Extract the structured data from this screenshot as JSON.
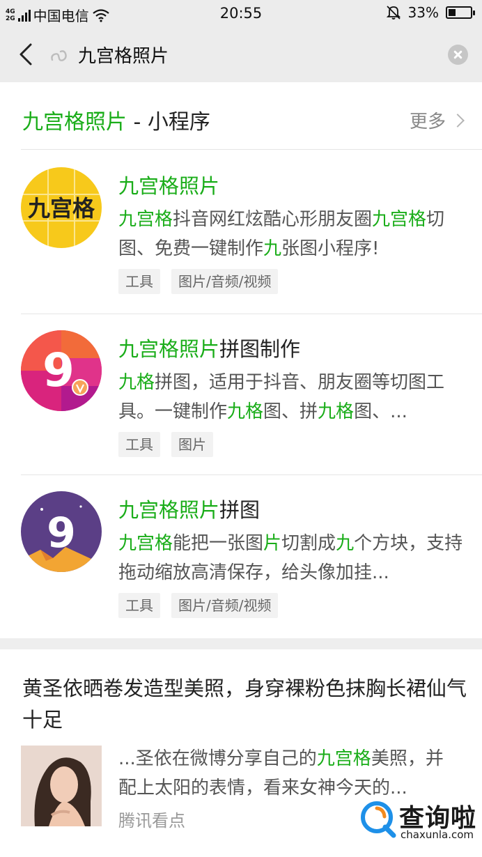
{
  "status_bar": {
    "network_top": "4G",
    "network_bottom": "2G",
    "carrier": "中国电信",
    "time": "20:55",
    "battery_percent": "33%",
    "battery_level": 0.33
  },
  "search": {
    "query": "九宫格照片",
    "icons": {
      "back": "back-arrow-icon",
      "mini_program": "mini-program-icon",
      "clear": "clear-icon"
    }
  },
  "mini_programs": {
    "title_highlight": "九宫格照片",
    "title_rest": " - 小程序",
    "more_label": "更多",
    "items": [
      {
        "name_highlight": "九宫格照片",
        "name_rest": "",
        "desc": [
          {
            "t": "九宫格",
            "h": true
          },
          {
            "t": "抖音网红炫酷心形朋友圈",
            "h": false
          },
          {
            "t": "九宫格",
            "h": true
          },
          {
            "t": "切图、免费一键制作",
            "h": false
          },
          {
            "t": "九",
            "h": true
          },
          {
            "t": "张图小程序!",
            "h": false
          }
        ],
        "tags": [
          "工具",
          "图片/音频/视频"
        ],
        "logo": "九宫格"
      },
      {
        "name_highlight": "九宫格照片",
        "name_rest": "拼图制作",
        "desc": [
          {
            "t": "九格",
            "h": true
          },
          {
            "t": "拼图，适用于抖音、朋友圈等切图工具。一键制作",
            "h": false
          },
          {
            "t": "九格",
            "h": true
          },
          {
            "t": "图、拼",
            "h": false
          },
          {
            "t": "九格",
            "h": true
          },
          {
            "t": "图、...",
            "h": false
          }
        ],
        "tags": [
          "工具",
          "图片"
        ],
        "logo": "9"
      },
      {
        "name_highlight": "九宫格照片",
        "name_rest": "拼图",
        "desc": [
          {
            "t": "九宫格",
            "h": true
          },
          {
            "t": "能把一张图",
            "h": false
          },
          {
            "t": "片",
            "h": true
          },
          {
            "t": "切割成",
            "h": false
          },
          {
            "t": "九",
            "h": true
          },
          {
            "t": "个方块，支持拖动缩放高清保存，给头像加挂...",
            "h": false
          }
        ],
        "tags": [
          "工具",
          "图片/音频/视频"
        ],
        "logo": "9"
      }
    ]
  },
  "article": {
    "title": "黄圣依晒卷发造型美照，身穿裸粉色抹胸长裙仙气十足",
    "snippet": [
      {
        "t": "...圣依在微博分享自己的",
        "h": false
      },
      {
        "t": "九宫格",
        "h": true
      },
      {
        "t": "美照，并配上太阳的表情，看来女神今天的...",
        "h": false
      }
    ],
    "source": "腾讯看点"
  },
  "watermark": {
    "text": "查询啦",
    "sub": "chaxunla.com"
  },
  "colors": {
    "accent": "#1aad19",
    "background": "#eeeeee"
  }
}
